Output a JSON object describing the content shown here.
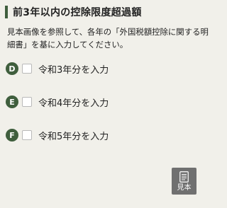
{
  "section": {
    "title": "前3年以内の控除限度超過額",
    "description": "見本画像を参照して、各年の「外国税額控除に関する明細書」を基に入力してください。"
  },
  "options": [
    {
      "badge": "D",
      "label": "令和3年分を入力",
      "checked": false
    },
    {
      "badge": "E",
      "label": "令和4年分を入力",
      "checked": false
    },
    {
      "badge": "F",
      "label": "令和5年分を入力",
      "checked": false
    }
  ],
  "sample_button": {
    "label": "見本",
    "icon": "document-icon"
  },
  "colors": {
    "accent": "#3f5e3d",
    "background": "#f1f0ea",
    "button": "#707070"
  }
}
